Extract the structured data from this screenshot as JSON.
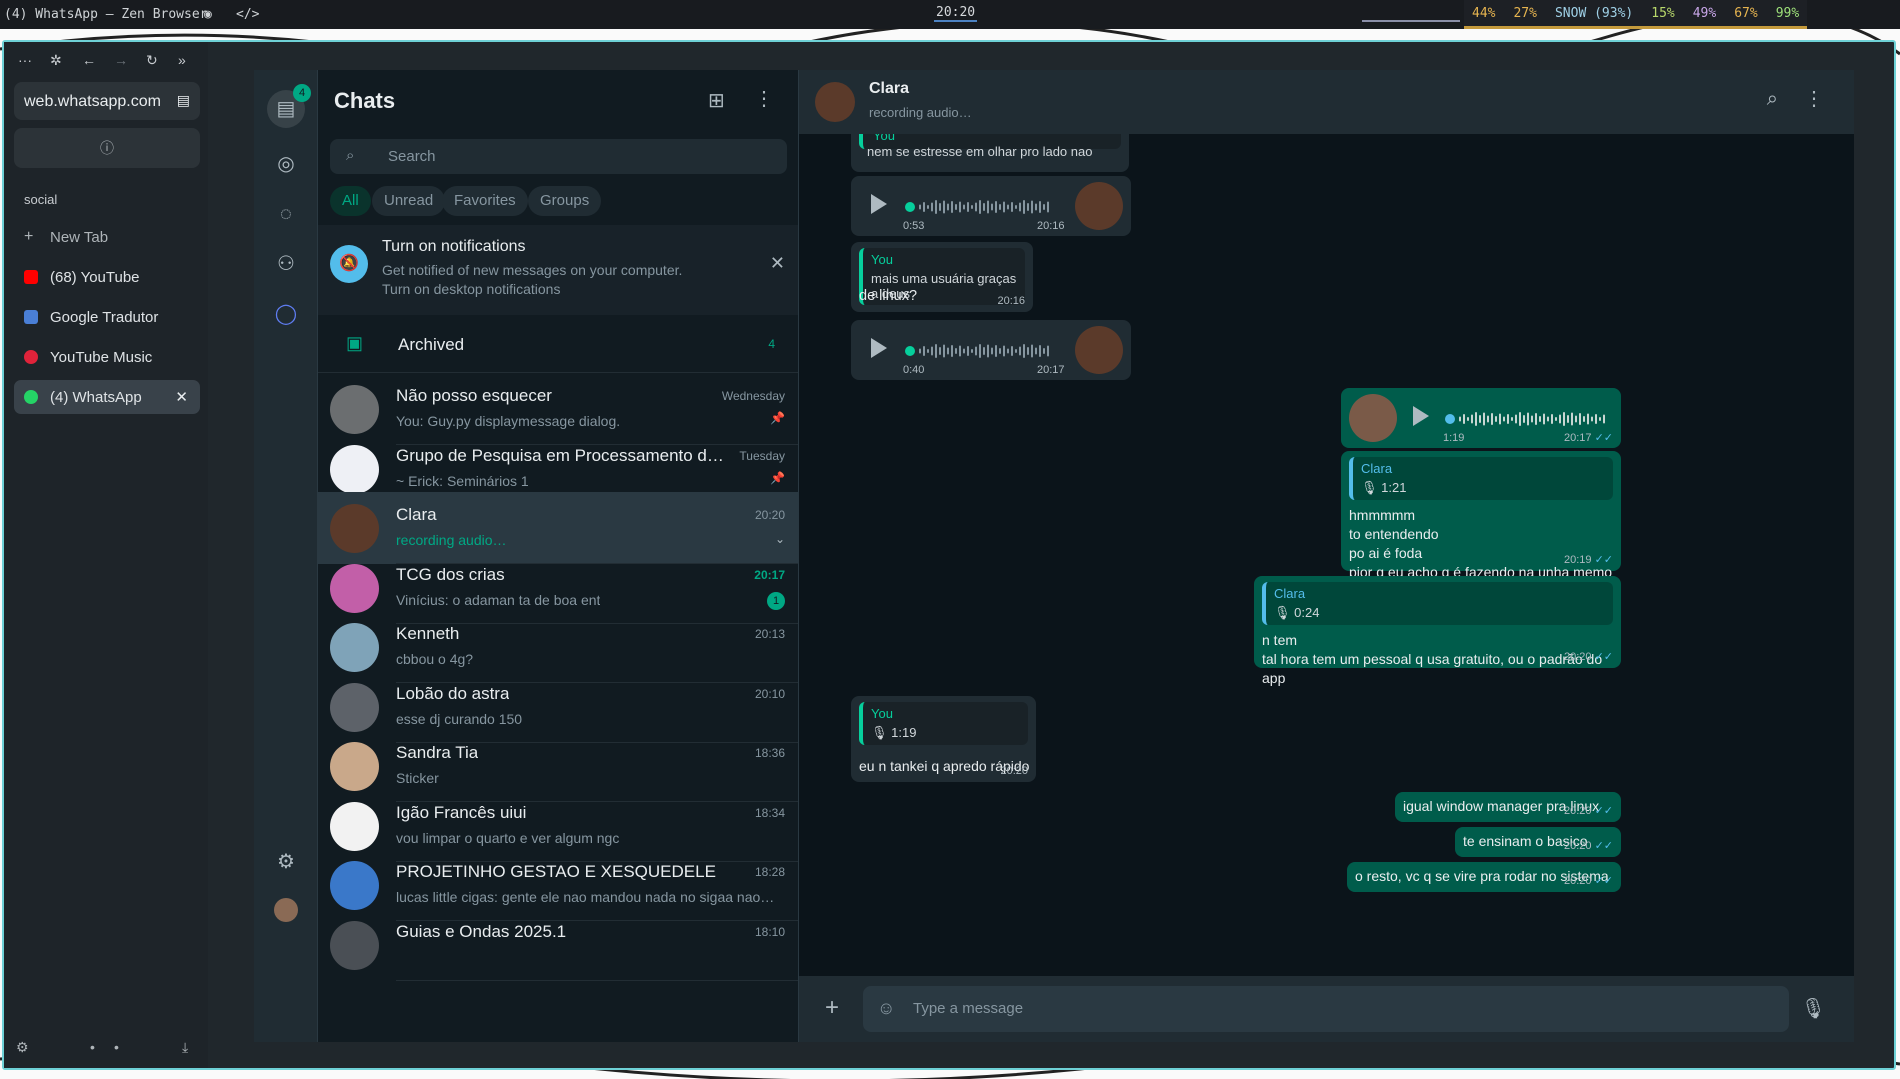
{
  "topbar": {
    "window_title": "(4) WhatsApp — Zen Browser",
    "clock": "20:20",
    "sysmon": [
      "44%",
      "27%",
      "SNOW (93%)",
      "15%",
      "49%",
      "67%",
      "99%"
    ]
  },
  "browser": {
    "url": "web.whatsapp.com",
    "workspace": "social",
    "new_tab": "New Tab",
    "tabs": [
      {
        "label": "(68) YouTube",
        "color": "#ff0000"
      },
      {
        "label": "Google Tradutor",
        "color": "#4a7fd6"
      },
      {
        "label": "YouTube Music",
        "color": "#e0233a"
      },
      {
        "label": "(4) WhatsApp",
        "color": "#25d366"
      }
    ]
  },
  "rail": {
    "chats_badge": "4"
  },
  "chatlist": {
    "title": "Chats",
    "search_placeholder": "Search",
    "filters": [
      "All",
      "Unread",
      "Favorites",
      "Groups"
    ],
    "notification": {
      "title": "Turn on notifications",
      "body": "Get notified of new messages on your computer.",
      "link": "Turn on desktop notifications"
    },
    "archived": {
      "label": "Archived",
      "count": "4"
    },
    "chats": [
      {
        "name": "Não posso esquecer",
        "preview": "You: Guy.py displaymessage dialog.",
        "time": "Wednesday",
        "avatar": "#6b6e70"
      },
      {
        "name": "Grupo de Pesquisa em Processamento d…",
        "preview": "~ Erick: Seminários 1",
        "time": "Tuesday",
        "avatar": "#eef0f5"
      },
      {
        "name": "Clara",
        "preview": "recording audio…",
        "time": "20:20",
        "avatar": "#5b3a2a"
      },
      {
        "name": "TCG dos crias",
        "preview": "Vinícius: o adaman ta de boa ent",
        "time": "20:17",
        "unread": "1",
        "avatar": "#c25fa8"
      },
      {
        "name": "Kenneth",
        "preview": "cbbou o 4g?",
        "time": "20:13",
        "avatar": "#7fa3b8"
      },
      {
        "name": "Lobão do astra",
        "preview": "esse dj curando 150",
        "time": "20:10",
        "avatar": "#5d6269"
      },
      {
        "name": "Sandra Tia",
        "preview": "Sticker",
        "time": "18:36",
        "avatar": "#c9a88a"
      },
      {
        "name": "Igão Francês uiui",
        "preview": "vou limpar o quarto e ver algum ngc",
        "time": "18:34",
        "avatar": "#f2f2f2"
      },
      {
        "name": "PROJETINHO GESTAO E XESQUEDELE",
        "preview": "lucas little cigas: gente ele nao mandou nada no sigaa nao…",
        "time": "18:28",
        "avatar": "#3a78c9"
      },
      {
        "name": "Guias e Ondas 2025.1",
        "preview": "",
        "time": "18:10",
        "avatar": "#4a4f55"
      }
    ]
  },
  "conversation": {
    "contact": "Clara",
    "status": "recording audio…",
    "input_placeholder": "Type a message",
    "messages": {
      "m1_quote_name": "You",
      "m1_text": "nem se estresse em olhar pro lado nao",
      "v1_dur": "0:53",
      "v1_time": "20:16",
      "m2_quote_name": "You",
      "m2_quote_text": "mais uma usuária graças a deus",
      "m2_text": "de linux?",
      "m2_time": "20:16",
      "v2_dur": "0:40",
      "v2_time": "20:17",
      "v3_dur": "1:19",
      "v3_time": "20:17",
      "m3_quote_name": "Clara",
      "m3_quote_voice": "1:21",
      "m3_lines": [
        "hmmmmm",
        "to entendendo",
        "po ai é foda",
        "pior q eu acho q é fazendo na unha memo"
      ],
      "m3_time": "20:19",
      "m4_quote_name": "Clara",
      "m4_quote_voice": "0:24",
      "m4_lines": [
        "n tem",
        "tal hora tem um pessoal q usa gratuito, ou o padrão do app"
      ],
      "m4_time": "20:20",
      "m5_quote_name": "You",
      "m5_quote_voice": "1:19",
      "m5_text": "eu n tankei q apredo rápido",
      "m5_time": "20:20",
      "m6_text": "igual window manager pra linux",
      "m6_time": "20:20",
      "m7_text": "te ensinam o basico",
      "m7_time": "20:20",
      "m8_text": "o resto, vc q se vire pra rodar no sistema",
      "m8_time": "20:20"
    }
  }
}
